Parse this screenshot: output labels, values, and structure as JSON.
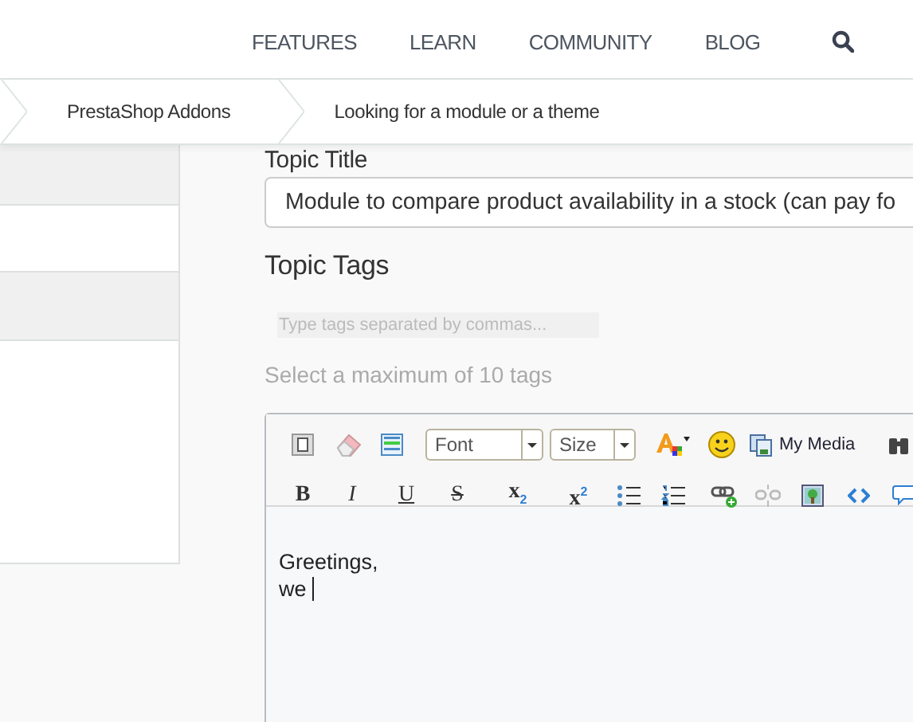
{
  "nav": {
    "items": [
      "FEATURES",
      "LEARN",
      "COMMUNITY",
      "BLOG"
    ]
  },
  "breadcrumbs": [
    "PrestaShop Addons",
    "Looking for a module or a theme"
  ],
  "form": {
    "title_label": "Topic Title",
    "title_value": "Module to compare product availability in a stock (can pay fo",
    "tags_label": "Topic Tags",
    "tags_placeholder": "Type tags separated by commas...",
    "tags_hint": "Select a maximum of 10 tags"
  },
  "editor": {
    "font_select": "Font",
    "size_select": "Size",
    "media_button": "My Media",
    "format_buttons": [
      "B",
      "I",
      "U",
      "S",
      "x$_{2}$",
      "x$^{2}$"
    ],
    "content": [
      "Greetings,",
      "we "
    ]
  }
}
